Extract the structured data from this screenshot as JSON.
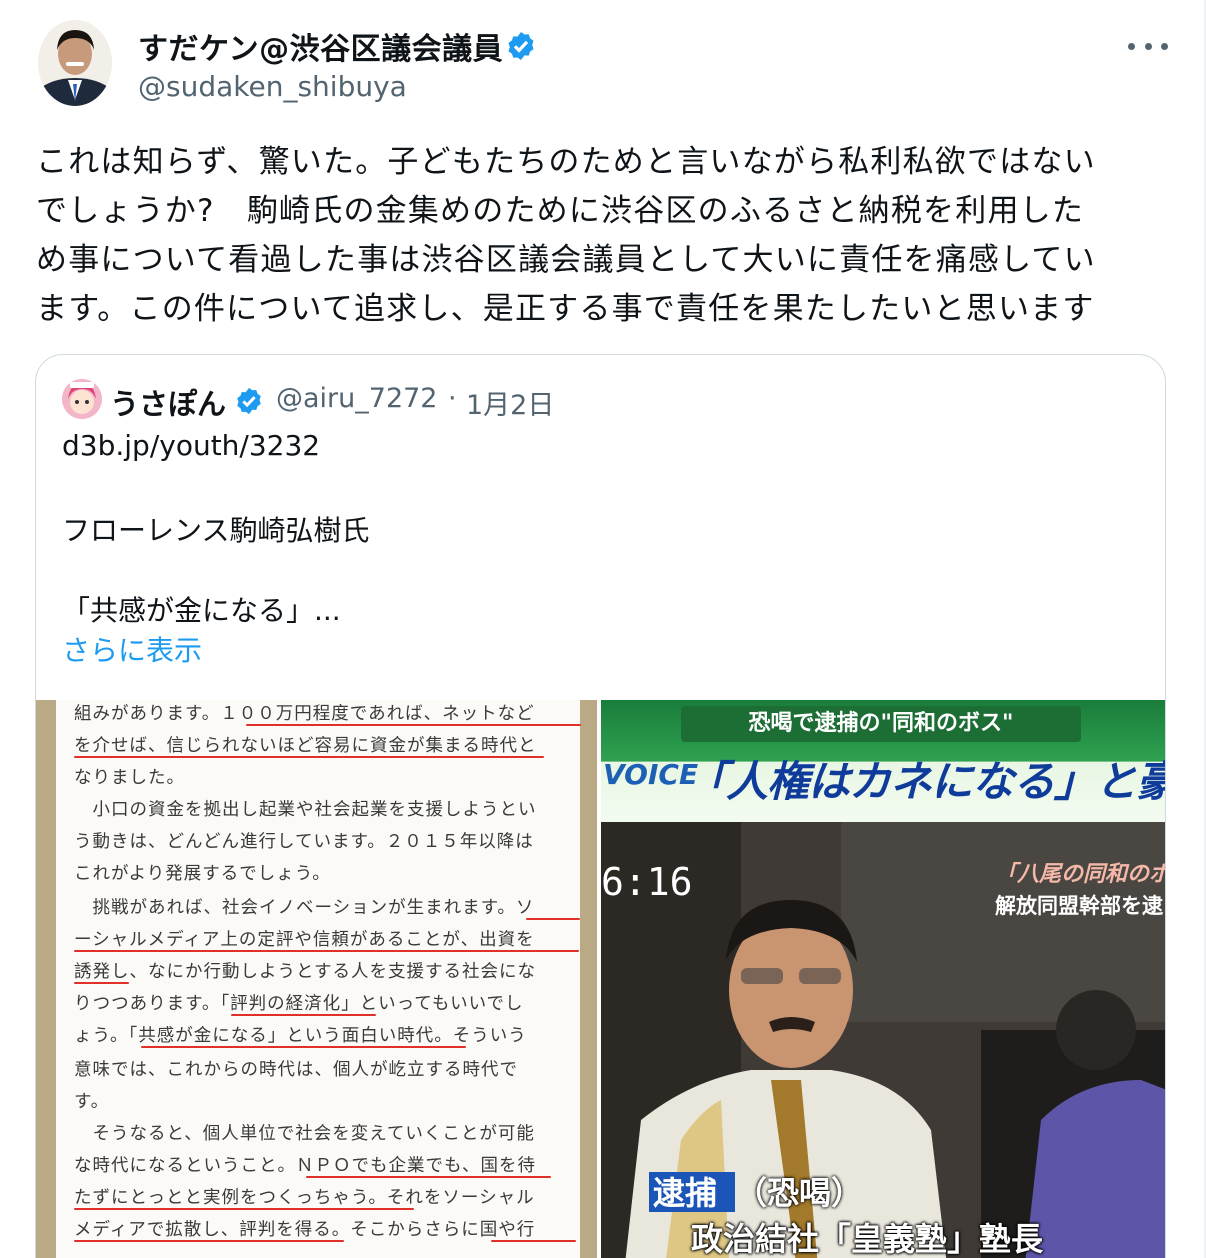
{
  "author": {
    "display_name": "すだケン@渋谷区議会議員",
    "handle": "@sudaken_shibuya",
    "verified_color": "#1d9bf0"
  },
  "more_icon": "more-horizontal-icon",
  "tweet": {
    "lines": [
      "これは知らず、驚いた。子どもたちのためと言いながら私利私欲ではない",
      "でしょうか?　駒崎氏の金集めのために渋谷区のふるさと納税を利用した",
      "め事について看過した事は渋谷区議会議員として大いに責任を痛感してい",
      "ます。この件について追求し、是正する事で責任を果たしたいと思います"
    ]
  },
  "quote": {
    "display_name": "うさぽん",
    "handle": "@airu_7272",
    "separator": "·",
    "date": "1月2日",
    "lines": [
      "d3b.jp/youth/3232",
      "フローレンス駒崎弘樹氏",
      "「共感が金になる」..."
    ],
    "show_more": "さらに表示"
  },
  "media": {
    "book_page": {
      "lines": [
        "組みがあります。１００万円程度であれば、ネットなど",
        "を介せば、信じられないほど容易に資金が集まる時代と",
        "なりました。",
        "　小口の資金を拠出し起業や社会起業を支援しようとい",
        "う動きは、どんどん進行しています。２０１５年以降は",
        "これがより発展するでしょう。",
        "　挑戦があれば、社会イノベーションが生まれます。ソ",
        "ーシャルメディア上の定評や信頼があることが、出資を",
        "誘発し、なにか行動しようとする人を支援する社会にな",
        "りつつあります。「評判の経済化」といってもいいでし",
        "ょう。「共感が金になる」という面白い時代。そういう",
        "意味では、これからの時代は、個人が屹立する時代で",
        "す。",
        "　そうなると、個人単位で社会を変えていくことが可能",
        "な時代になるということ。ＮＰＯでも企業でも、国を待",
        "たずにとっとと実例をつくっちゃう。それをソーシャル",
        "メディアで拡散し、評判を得る。そこからさらに国や行"
      ]
    },
    "tv_screenshot": {
      "banner": "恐喝で逮捕の\"同和のボス\"",
      "logo": "VOICE",
      "headline": "「人権はカネになる」と豪語",
      "time": "6:16",
      "side_title": "「八尾の同和のボ",
      "side_sub": "解放同盟幹部を逮",
      "caption_tag": "逮捕",
      "caption_tag_rest": "（恐喝）",
      "caption_main": "政治結社「皇義塾」塾長"
    }
  }
}
